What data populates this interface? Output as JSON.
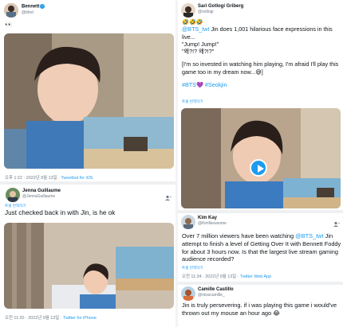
{
  "tweets": {
    "bennett": {
      "name": "Bennett",
      "handle": "@bfod",
      "text": "👀",
      "meta_time": "오후 1:22 · 2022년 9월 13일 · ",
      "meta_source": "Tweetbot for iOS"
    },
    "jenna": {
      "name": "Jenna Guillaume",
      "handle": "@JennaGuillaume",
      "translate": "트윗 번역하기",
      "text": "Just checked back in with Jin, is he ok",
      "meta_time": "오전 11:20 · 2022년 9월 13일 · ",
      "meta_source": "Twitter for iPhone"
    },
    "sari": {
      "name": "Sari Gotlogi Griberg",
      "handle": "@sotlogi",
      "emojis": "🤣🤣🤣",
      "mention": "@BTS_twt",
      "line1_rest": " Jin does 1,001 hilarious face expressions in this live...",
      "line2": "\"Jump! Jump!\"",
      "line3": "\"왜?!? 왜?!?\"",
      "line4": "[I'm so invested in watching him playing, I'm afraid I'll play this game too in my dream now...😅]",
      "hashtags": "#BTS💜 #Seokjin",
      "translate": "트윗 번역하기"
    },
    "kim": {
      "name": "Kim Kay",
      "handle": "@KimNewsome",
      "text_a": "Over 7 million viewers have been watching ",
      "mention": "@BTS_twt",
      "text_b": " Jin attempt to finish a level of Getting Over It with Bennett Foddy for about 3 hours now. Is that the largest live stream gaming audience recorded?",
      "translate": "트윗 번역하기",
      "meta_time": "오전 11:34 · 2022년 9월 13일 · ",
      "meta_source": "Twitter Web App"
    },
    "camille": {
      "name": "Camille Castillo",
      "handle": "@misscamille_",
      "text": "Jin is truly persevering. if i was playing this game i would've thrown out my mouse an hour ago 😂"
    }
  },
  "colors": {
    "accent": "#1d9bf0",
    "text": "#0f1419",
    "muted": "#6e7b86",
    "separator": "#eef0f2"
  },
  "icons": [
    "verified-badge-icon",
    "add-user-icon",
    "play-icon"
  ]
}
